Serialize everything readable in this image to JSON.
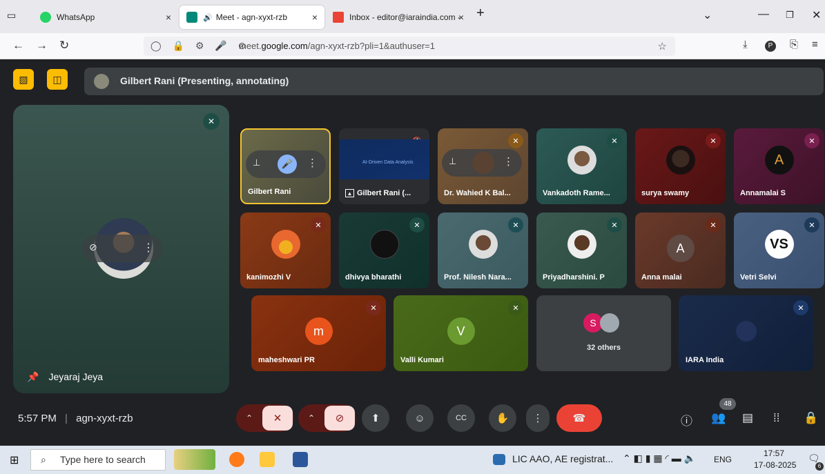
{
  "browser": {
    "tabs": [
      {
        "title": "WhatsApp",
        "close": "×"
      },
      {
        "title": "Meet - agn-xyxt-rzb",
        "close": "×"
      },
      {
        "title": "Inbox - editor@iaraindia.com - ",
        "close": "×"
      }
    ],
    "new_tab": "+",
    "url_prefix": "meet.",
    "url_domain": "google.com",
    "url_path": "/agn-xyxt-rzb?pli=1&authuser=1"
  },
  "meet": {
    "presenting_text": "Gilbert Rani (Presenting, annotating)",
    "pinned_name": "Jeyaraj Jeya",
    "tiles_row1": [
      {
        "name": "Gilbert Rani"
      },
      {
        "name": "Gilbert Rani (...",
        "slide_title": "AI-Driven Data Analysis"
      },
      {
        "name": "Dr. Wahied K Bal..."
      },
      {
        "name": "Vankadoth Rame..."
      },
      {
        "name": "surya swamy"
      },
      {
        "name": "Annamalai S"
      }
    ],
    "tiles_row2": [
      {
        "name": "kanimozhi V"
      },
      {
        "name": "dhivya bharathi"
      },
      {
        "name": "Prof. Nilesh Nara..."
      },
      {
        "name": "Priyadharshini. P"
      },
      {
        "name": "Anna malai",
        "letter": "A"
      },
      {
        "name": "Vetri Selvi"
      }
    ],
    "tiles_row3": [
      {
        "name": "maheshwari PR",
        "letter": "m"
      },
      {
        "name": "Valli Kumari",
        "letter": "V"
      },
      {
        "name": "32 others",
        "letter": "S"
      },
      {
        "name": "IARA India"
      }
    ],
    "time": "5:57 PM",
    "separator": "|",
    "meeting_code": "agn-xyxt-rzb",
    "participants_count": "48"
  },
  "taskbar": {
    "search_placeholder": "Type here to search",
    "notification": "LIC AAO, AE registrat...",
    "lang": "ENG",
    "time": "17:57",
    "date": "17-08-2025",
    "notif_count": "6"
  },
  "colors": {
    "accent_yellow": "#fbbc04",
    "end_call_red": "#ea4335",
    "mic_off_red": "#8c1d18",
    "presenter_border": "#f4c430"
  }
}
